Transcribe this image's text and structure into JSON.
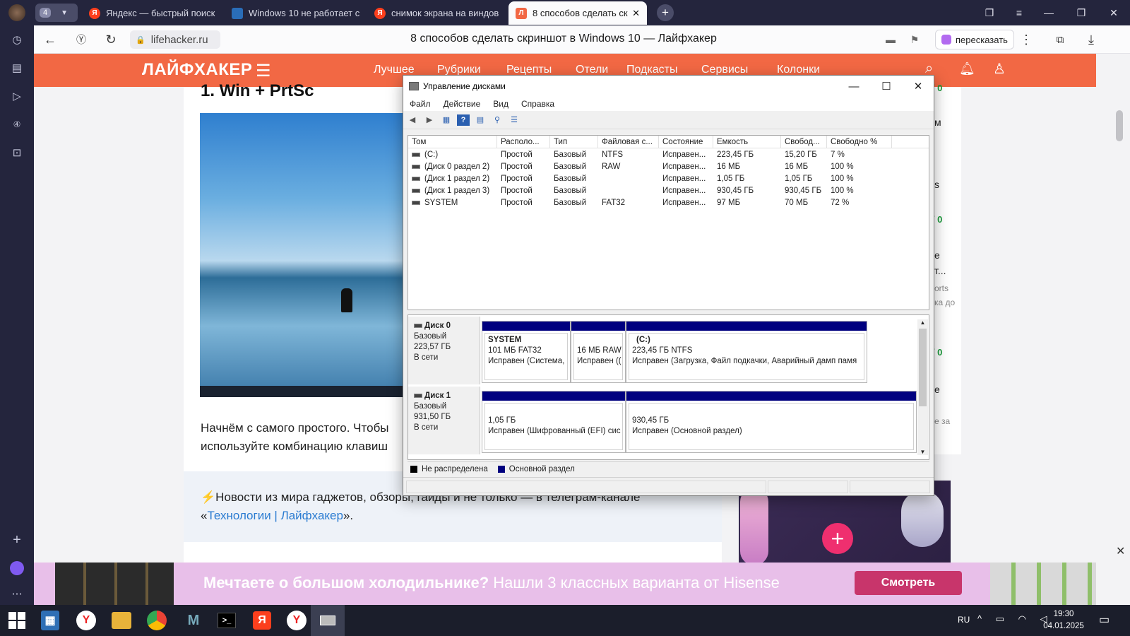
{
  "browser": {
    "tab_count": "4",
    "tabs": [
      {
        "label": "Яндекс — быстрый поиск"
      },
      {
        "label": "Windows 10 не работает с"
      },
      {
        "label": "снимок экрана на виндов"
      },
      {
        "label": "8 способов сделать скр"
      }
    ],
    "address": "lifehacker.ru",
    "page_title": "8 способов сделать скриншот в Windows 10 — Лайфхакер",
    "summarize_label": "пересказать"
  },
  "site": {
    "logo": "ЛАЙФХАКЕР",
    "nav": [
      "Лучшее",
      "Рубрики",
      "Рецепты",
      "Отели",
      "Подкасты",
      "Сервисы",
      "Колонки"
    ],
    "heading": "1. Win + PrtSc",
    "para1": "Начнём с самого простого. Чтобы",
    "para2": "используйте комбинацию клавиш",
    "promo_text": "⚡Новости из мира гаджетов, обзоры, гайды и не только — в телеграм-канале «",
    "promo_link": "Технологии | Лайфхакер",
    "promo_end": "».",
    "side_counters": [
      "0 / 0",
      "0 / 0",
      "0 / 0"
    ],
    "side_frags": [
      "м",
      "s",
      "е",
      "т...",
      "orts",
      "ка до",
      "е",
      "е за"
    ]
  },
  "banner": {
    "bold": "Мечтаете о большом холодильнике?",
    "rest": " Нашли 3 классных варианта от Hisense",
    "button": "Смотреть"
  },
  "dm": {
    "title": "Управление дисками",
    "menu": [
      "Файл",
      "Действие",
      "Вид",
      "Справка"
    ],
    "columns": [
      "Том",
      "Располо...",
      "Тип",
      "Файловая с...",
      "Состояние",
      "Емкость",
      "Свобод...",
      "Свободно %"
    ],
    "rows": [
      [
        "(C:)",
        "Простой",
        "Базовый",
        "NTFS",
        "Исправен...",
        "223,45 ГБ",
        "15,20 ГБ",
        "7 %"
      ],
      [
        "(Диск 0 раздел 2)",
        "Простой",
        "Базовый",
        "RAW",
        "Исправен...",
        "16 МБ",
        "16 МБ",
        "100 %"
      ],
      [
        "(Диск 1 раздел 2)",
        "Простой",
        "Базовый",
        "",
        "Исправен...",
        "1,05 ГБ",
        "1,05 ГБ",
        "100 %"
      ],
      [
        "(Диск 1 раздел 3)",
        "Простой",
        "Базовый",
        "",
        "Исправен...",
        "930,45 ГБ",
        "930,45 ГБ",
        "100 %"
      ],
      [
        "SYSTEM",
        "Простой",
        "Базовый",
        "FAT32",
        "Исправен...",
        "97 МБ",
        "70 МБ",
        "72 %"
      ]
    ],
    "disks": [
      {
        "name": "Диск 0",
        "type": "Базовый",
        "size": "223,57 ГБ",
        "state": "В сети",
        "parts": [
          {
            "name": "SYSTEM",
            "fs": "101 МБ FAT32",
            "status": "Исправен (Система,"
          },
          {
            "name": "",
            "fs": "16 МБ RAW",
            "status": "Исправен (("
          },
          {
            "name": "(C:)",
            "fs": "223,45 ГБ NTFS",
            "status": "Исправен (Загрузка, Файл подкачки, Аварийный дамп памя"
          }
        ]
      },
      {
        "name": "Диск 1",
        "type": "Базовый",
        "size": "931,50 ГБ",
        "state": "В сети",
        "parts": [
          {
            "name": "",
            "fs": "1,05 ГБ",
            "status": "Исправен (Шифрованный (EFI) сис"
          },
          {
            "name": "",
            "fs": "930,45 ГБ",
            "status": "Исправен (Основной раздел)"
          }
        ]
      }
    ],
    "legend": [
      "Не распределена",
      "Основной раздел"
    ],
    "colors": {
      "unallocated": "#000000",
      "primary": "#00007f"
    }
  },
  "taskbar": {
    "lang": "RU",
    "time": "19:30",
    "date": "04.01.2025"
  }
}
